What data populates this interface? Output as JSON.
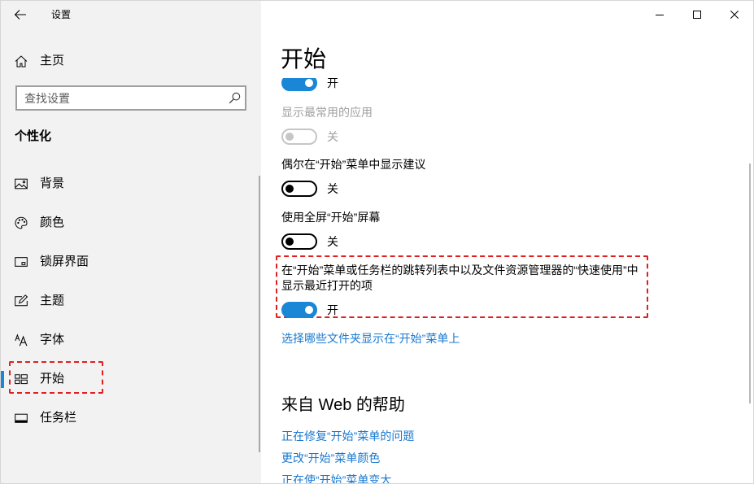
{
  "window": {
    "title": "设置",
    "back_icon": "back-arrow-icon",
    "controls": [
      "minimize-icon",
      "maximize-icon",
      "close-icon"
    ]
  },
  "sidebar": {
    "home": {
      "label": "主页",
      "icon": "home-icon"
    },
    "search": {
      "placeholder": "查找设置",
      "icon": "search-icon"
    },
    "section_title": "个性化",
    "items": [
      {
        "label": "背景",
        "icon": "picture-icon",
        "selected": false
      },
      {
        "label": "颜色",
        "icon": "palette-icon",
        "selected": false
      },
      {
        "label": "锁屏界面",
        "icon": "lock-screen-icon",
        "selected": false
      },
      {
        "label": "主题",
        "icon": "theme-icon",
        "selected": false
      },
      {
        "label": "字体",
        "icon": "font-icon",
        "selected": false
      },
      {
        "label": "开始",
        "icon": "start-icon",
        "selected": true,
        "highlighted": true
      },
      {
        "label": "任务栏",
        "icon": "taskbar-icon",
        "selected": false
      }
    ]
  },
  "main": {
    "title": "开始",
    "settings": [
      {
        "state_label": "开",
        "on": true,
        "enabled": true
      },
      {
        "label": "显示最常用的应用",
        "state_label": "关",
        "on": false,
        "enabled": false
      },
      {
        "label": "偶尔在“开始”菜单中显示建议",
        "state_label": "关",
        "on": false,
        "enabled": true
      },
      {
        "label": "使用全屏“开始”屏幕",
        "state_label": "关",
        "on": false,
        "enabled": true
      },
      {
        "label_lines": [
          "在“开始”菜单或任务栏的跳转列表中以及文件资源管理器的“快速使用”中",
          "显示最近打开的项"
        ],
        "state_label": "开",
        "on": true,
        "enabled": true,
        "highlighted": true
      }
    ],
    "folders_link": "选择哪些文件夹显示在“开始”菜单上",
    "help": {
      "title": "来自 Web 的帮助",
      "links": [
        "正在修复“开始”菜单的问题",
        "更改“开始”菜单颜色",
        "正在使“开始”菜单变大"
      ]
    }
  },
  "colors": {
    "accent": "#1a86d6",
    "link": "#1a78cf",
    "annotation": "#e02020",
    "sidebar_bg": "#f2f2f2",
    "disabled": "#a0a0a0"
  }
}
